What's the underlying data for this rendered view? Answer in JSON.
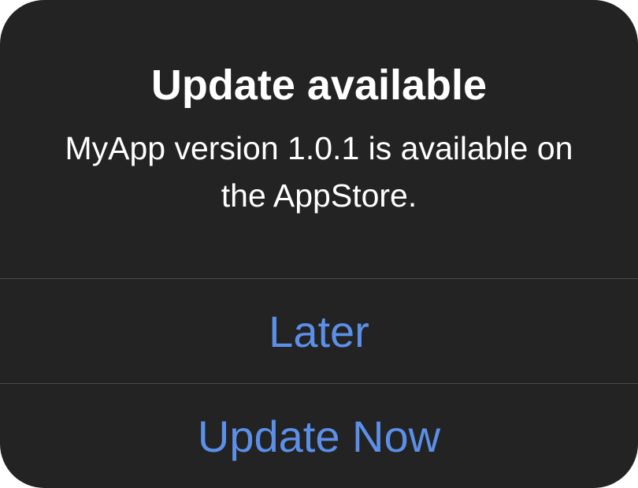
{
  "alert": {
    "title": "Update available",
    "message": "MyApp version 1.0.1 is available on the AppStore.",
    "buttons": {
      "later_label": "Later",
      "update_label": "Update Now"
    }
  },
  "colors": {
    "background": "#232323",
    "text": "#ffffff",
    "button_accent": "#5b8fe8",
    "divider": "#4a4a4a"
  }
}
